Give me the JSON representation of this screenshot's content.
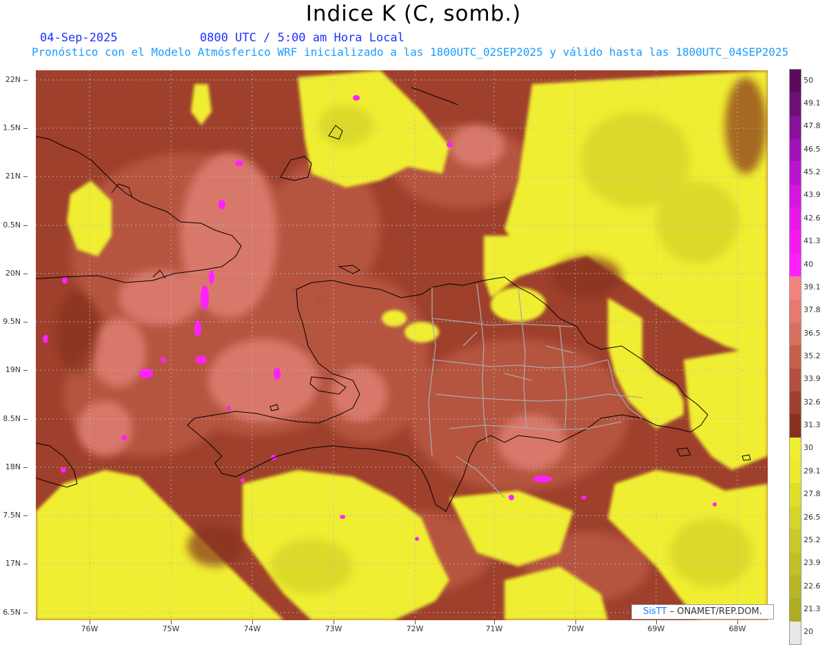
{
  "header": {
    "title": "Indice K (C, somb.)",
    "date": "04-Sep-2025",
    "time": "0800 UTC / 5:00 am Hora Local",
    "subtitle": "Pronóstico con el Modelo Atmósferico WRF inicializado a las 1800UTC_02SEP2025 y válido hasta las  1800UTC_04SEP2025"
  },
  "axes": {
    "lat_labels": [
      "22N",
      "1.5N",
      "21N",
      "0.5N",
      "20N",
      "9.5N",
      "19N",
      "8.5N",
      "18N",
      "7.5N",
      "17N",
      "6.5N"
    ],
    "lon_labels": [
      "76W",
      "75W",
      "74W",
      "73W",
      "72W",
      "71W",
      "70W",
      "69W",
      "68W"
    ]
  },
  "colorbar": {
    "labels": [
      "50",
      "49.1",
      "47.8",
      "46.5",
      "45.2",
      "43.9",
      "42.6",
      "41.3",
      "40",
      "39.1",
      "37.8",
      "36.5",
      "35.2",
      "33.9",
      "32.6",
      "31.3",
      "30",
      "29.1",
      "27.8",
      "26.5",
      "25.2",
      "23.9",
      "22.6",
      "21.3",
      "20"
    ],
    "colors": [
      "#5c0a5c",
      "#6e0f78",
      "#88109a",
      "#a012b8",
      "#bb14d0",
      "#d516e0",
      "#e818ea",
      "#f41af2",
      "#ff20ff",
      "#f28482",
      "#e67a70",
      "#d9705f",
      "#c85e4c",
      "#b54f3d",
      "#9e402c",
      "#86321c",
      "#f0ee30",
      "#ebea2f",
      "#e0de2d",
      "#d5d42b",
      "#cbca29",
      "#c1c027",
      "#b7b625",
      "#adac23",
      "#e8e8e8"
    ]
  },
  "map": {
    "colors": {
      "yellow": "#f0ee30",
      "yellow_shade": "#d8d62c",
      "brown": "#8a3a1e",
      "red": "#b55540",
      "salmon": "#d8786a",
      "magenta": "#ff20ff",
      "coast": "#000000",
      "province_lines": "#a8a8a8"
    }
  },
  "credit": {
    "brand": "SisTT",
    "rest": "– ONAMET/REP.DOM."
  }
}
